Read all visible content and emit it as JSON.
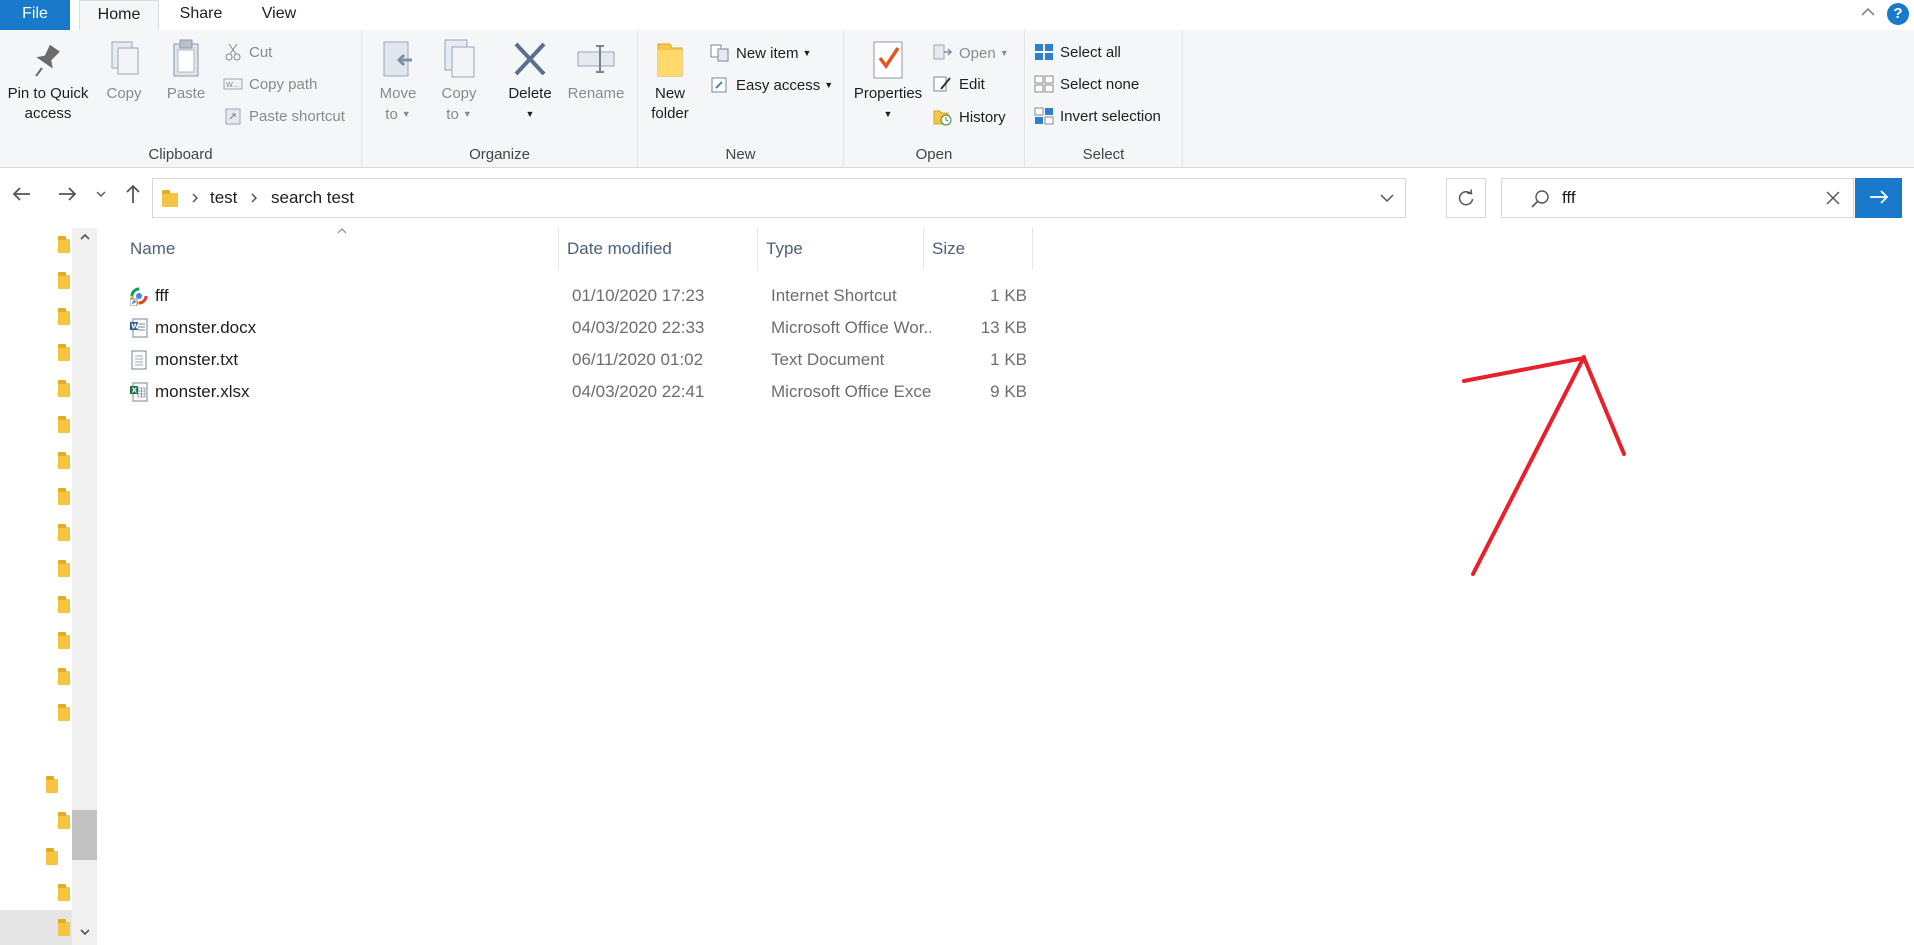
{
  "menu": {
    "tabs": [
      {
        "label": "File"
      },
      {
        "label": "Home"
      },
      {
        "label": "Share"
      },
      {
        "label": "View"
      }
    ],
    "help_label": "?"
  },
  "ribbon": {
    "clipboard": {
      "label": "Clipboard",
      "pin_label_1": "Pin to Quick",
      "pin_label_2": "access",
      "copy_label": "Copy",
      "paste_label": "Paste",
      "cut_label": "Cut",
      "copy_path_label": "Copy path",
      "paste_shortcut_label": "Paste shortcut"
    },
    "organize": {
      "label": "Organize",
      "move_label_1": "Move",
      "move_label_2": "to",
      "copy_to_label_1": "Copy",
      "copy_to_label_2": "to",
      "delete_label": "Delete",
      "rename_label": "Rename"
    },
    "new": {
      "label": "New",
      "new_folder_label_1": "New",
      "new_folder_label_2": "folder",
      "new_item_label": "New item",
      "easy_access_label": "Easy access"
    },
    "open": {
      "label": "Open",
      "properties_label": "Properties",
      "open_label": "Open",
      "edit_label": "Edit",
      "history_label": "History"
    },
    "select": {
      "label": "Select",
      "select_all_label": "Select all",
      "select_none_label": "Select none",
      "invert_label": "Invert selection"
    }
  },
  "address": {
    "crumbs": [
      "test",
      "search test"
    ]
  },
  "search": {
    "value": "fff"
  },
  "columns": {
    "name": "Name",
    "date": "Date modified",
    "type": "Type",
    "size": "Size"
  },
  "files": [
    {
      "name": "fff",
      "date": "01/10/2020 17:23",
      "type": "Internet Shortcut",
      "size": "1 KB",
      "icon": "internet-shortcut-icon"
    },
    {
      "name": "monster.docx",
      "date": "04/03/2020 22:33",
      "type": "Microsoft Office Wor...",
      "size": "13 KB",
      "icon": "word-document-icon"
    },
    {
      "name": "monster.txt",
      "date": "06/11/2020 01:02",
      "type": "Text Document",
      "size": "1 KB",
      "icon": "text-document-icon"
    },
    {
      "name": "monster.xlsx",
      "date": "04/03/2020 22:41",
      "type": "Microsoft Office Exce...",
      "size": "9 KB",
      "icon": "excel-document-icon"
    }
  ],
  "colors": {
    "accent": "#1979ca",
    "annotation": "#e8202a"
  }
}
